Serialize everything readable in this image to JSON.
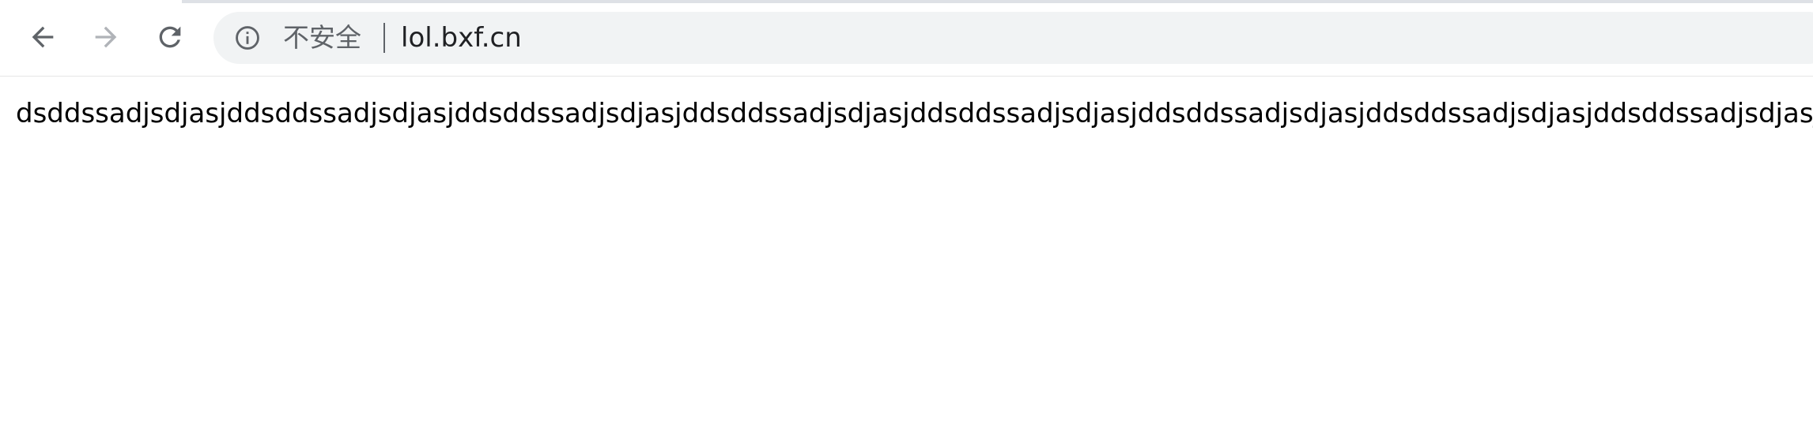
{
  "browser": {
    "security_label": "不安全",
    "url": "lol.bxf.cn",
    "icons": {
      "back": "arrow-left-icon",
      "forward": "arrow-right-icon",
      "reload": "reload-icon",
      "info": "info-icon"
    },
    "colors": {
      "toolbar_bg": "#ffffff",
      "omnibox_bg": "#f1f3f4",
      "icon_active": "#5f6368",
      "icon_disabled": "#b0b3b8",
      "url_text": "#202124"
    }
  },
  "page": {
    "text": "dsddssadjsdjasjddsddssadjsdjasjddsddssadjsdjasjddsddssadjsdjasjddsddssadjsdjasjddsddssadjsdjasjddsddssadjsdjasjddsddssadjsdjasjddsddssadjsdjasjd"
  }
}
